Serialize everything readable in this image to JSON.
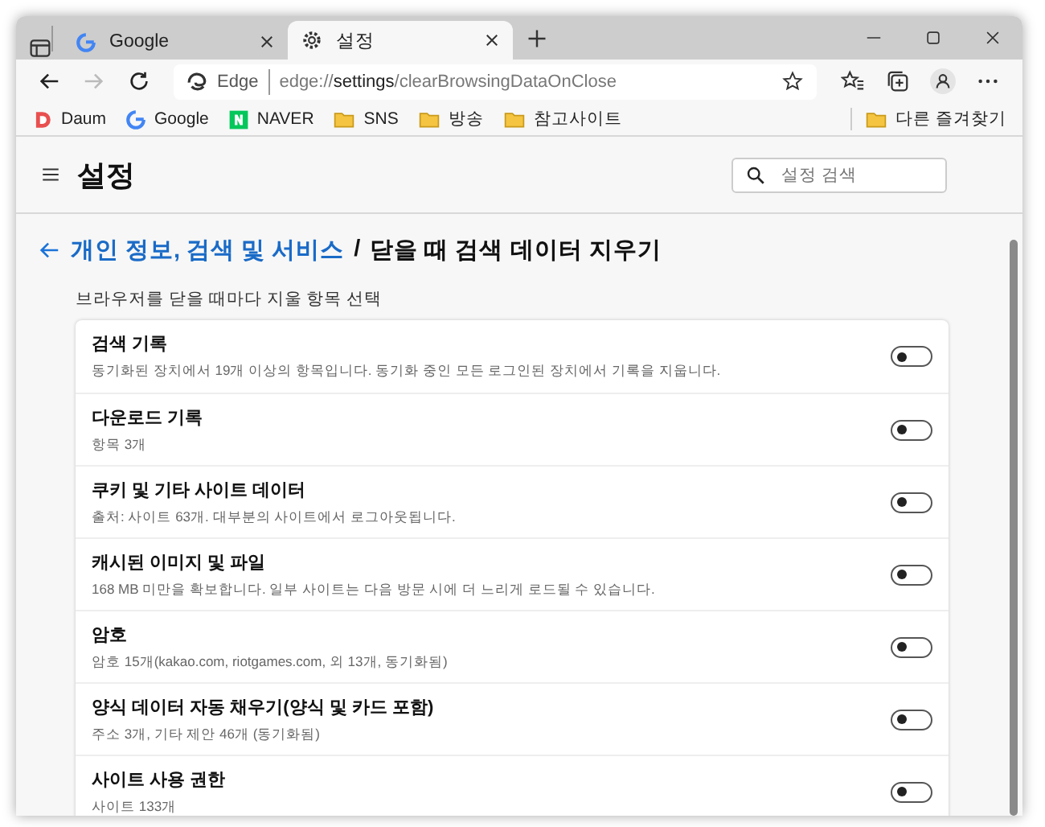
{
  "tabs": [
    {
      "title": "Google",
      "kind": "google",
      "selected": false
    },
    {
      "title": "설정",
      "kind": "gear",
      "selected": true
    }
  ],
  "address": {
    "badge": "Edge",
    "host": "edge://",
    "path_bold": "settings",
    "path": "/clearBrowsingDataOnClose"
  },
  "bookmarks": [
    {
      "label": "Daum",
      "kind": "daum"
    },
    {
      "label": "Google",
      "kind": "google"
    },
    {
      "label": "NAVER",
      "kind": "naver"
    },
    {
      "label": "SNS",
      "kind": "folder"
    },
    {
      "label": "방송",
      "kind": "folder"
    },
    {
      "label": "참고사이트",
      "kind": "folder"
    }
  ],
  "other_bookmarks": "다른 즐겨찾기",
  "settings": {
    "title": "설정",
    "search_placeholder": "설정 검색"
  },
  "breadcrumb": {
    "parent": "개인 정보, 검색 및 서비스",
    "separator": "/",
    "current": "닫을 때 검색 데이터 지우기"
  },
  "section_label": "브라우저를 닫을 때마다 지울 항목 선택",
  "items": [
    {
      "title": "검색 기록",
      "detail": "동기화된 장치에서 19개 이상의 항목입니다. 동기화 중인 모든 로그인된 장치에서 기록을 지웁니다.",
      "on": false
    },
    {
      "title": "다운로드 기록",
      "detail": "항목 3개",
      "on": false
    },
    {
      "title": "쿠키 및 기타 사이트 데이터",
      "detail": "출처: 사이트 63개. 대부분의 사이트에서 로그아웃됩니다.",
      "on": false
    },
    {
      "title": "캐시된 이미지 및 파일",
      "detail": "168 MB 미만을 확보합니다. 일부 사이트는 다음 방문 시에 더 느리게 로드될 수 있습니다.",
      "on": false
    },
    {
      "title": "암호",
      "detail": "암호 15개(kakao.com, riotgames.com, 외 13개, 동기화됨)",
      "on": false
    },
    {
      "title": "양식 데이터 자동 채우기(양식 및 카드 포함)",
      "detail": "주소 3개, 기타 제안 46개 (동기화됨)",
      "on": false
    },
    {
      "title": "사이트 사용 권한",
      "detail": "사이트 133개",
      "on": false
    }
  ]
}
